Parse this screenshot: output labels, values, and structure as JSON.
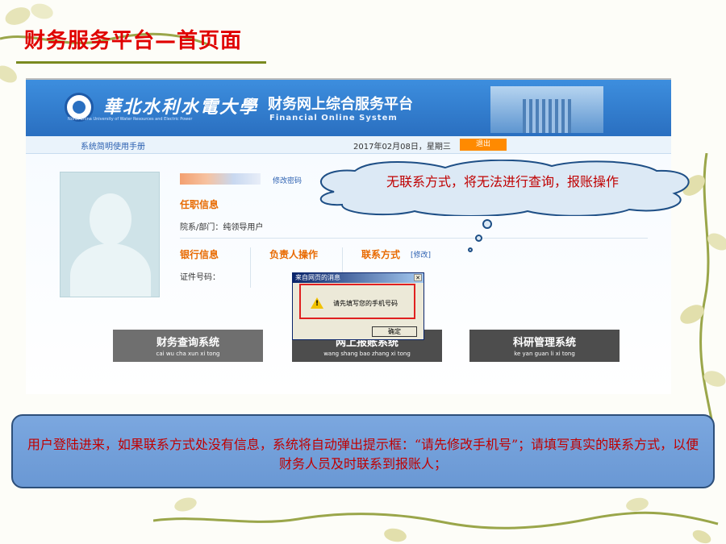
{
  "slide": {
    "title": "财务服务平台—首页面"
  },
  "portal": {
    "university_name": "華北水利水電大學",
    "university_name_en": "North China University of Water Resources and Electric Power",
    "platform_name": "财务网上综合服务平台",
    "platform_name_en": "Financial  Online  System",
    "nav": {
      "manual_link": "系统简明使用手册",
      "date": "2017年02月08日，星期三",
      "logout": "退出"
    },
    "profile": {
      "change_password": "修改密码",
      "job_info_heading": "任职信息",
      "department": "院系/部门：纯领导用户",
      "bank_info_heading": "银行信息",
      "manager_op_heading": "负责人操作",
      "contact_heading": "联系方式",
      "edit_contact": "[修改]",
      "id_number_label": "证件号码："
    },
    "systems": [
      {
        "name": "财务查询系统",
        "pinyin": "cai wu cha xun xi tong"
      },
      {
        "name": "网上报账系统",
        "pinyin": "wang shang bao zhang xi tong"
      },
      {
        "name": "科研管理系统",
        "pinyin": "ke yan guan li xi tong"
      }
    ],
    "alert": {
      "title": "来自网页的消息",
      "close": "✕",
      "message": "请先填写您的手机号码",
      "ok": "确定"
    }
  },
  "callout": {
    "text": "无联系方式，将无法进行查询，报账操作"
  },
  "info": {
    "text": "用户登陆进来，如果联系方式处没有信息，系统将自动弹出提示框：“请先修改手机号”；请填写真实的联系方式，以便财务人员及时联系到报账人；"
  },
  "colors": {
    "title_red": "#e00000",
    "banner_blue": "#2a6fc0",
    "heading_orange": "#e86a00",
    "logout_orange": "#ff8a00",
    "info_box_blue": "#7ba7df"
  }
}
